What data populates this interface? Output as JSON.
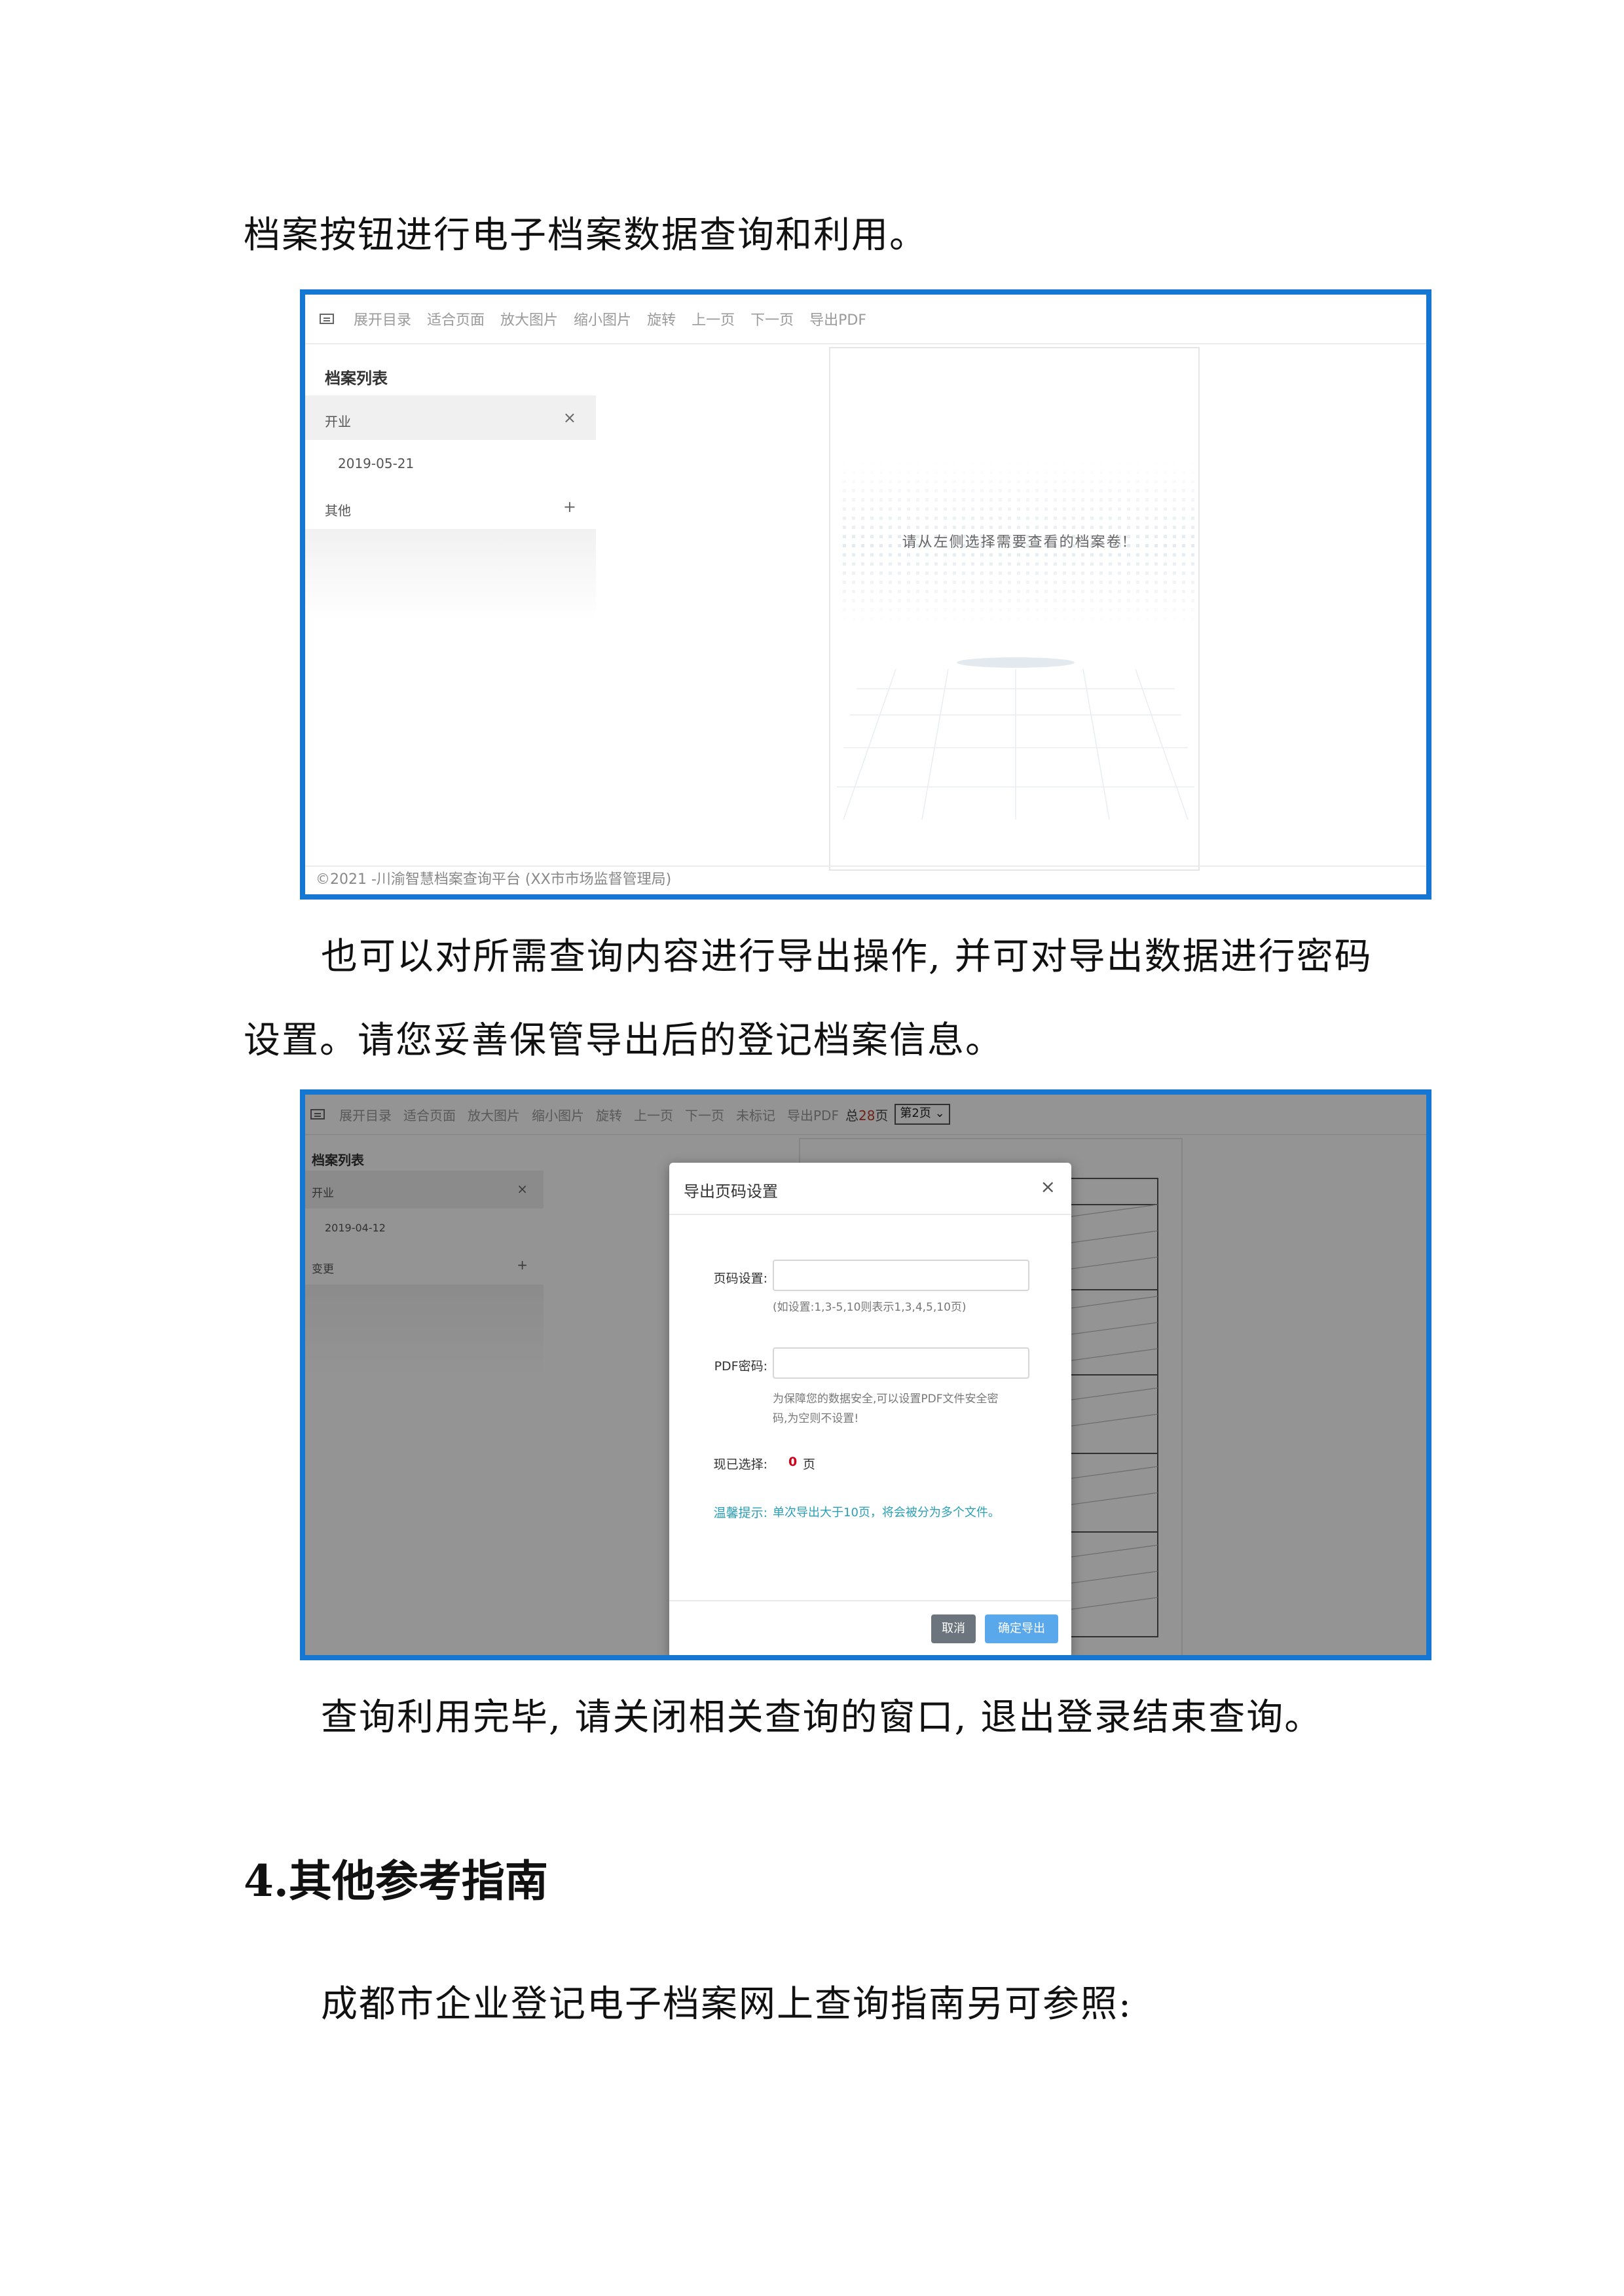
{
  "paragraphs": {
    "p1": "档案按钮进行电子档案数据查询和利用。",
    "p2_line1": "也可以对所需查询内容进行导出操作, 并可对导出数据进行密码",
    "p2_line2": "设置。请您妥善保管导出后的登记档案信息。",
    "p3": "查询利用完毕, 请关闭相关查询的窗口, 退出登录结束查询。",
    "p4": "成都市企业登记电子档案网上查询指南另可参照:"
  },
  "heading": "4.其他参考指南",
  "screenshot1": {
    "toolbar": [
      "展开目录",
      "适合页面",
      "放大图片",
      "缩小图片",
      "旋转",
      "上一页",
      "下一页",
      "导出PDF"
    ],
    "sidebar_title": "档案列表",
    "rows": [
      {
        "label": "开业",
        "action": "×"
      },
      {
        "label": "2019-05-21",
        "action": ""
      },
      {
        "label": "其他",
        "action": "+"
      }
    ],
    "placeholder_text": "请从左侧选择需要查看的档案卷!",
    "footer": "©2021 -川渝智慧档案查询平台 (XX市市场监督管理局)"
  },
  "screenshot2": {
    "toolbar": [
      "展开目录",
      "适合页面",
      "放大图片",
      "缩小图片",
      "旋转",
      "上一页",
      "下一页",
      "未标记",
      "导出PDF"
    ],
    "total_prefix": "总",
    "total_pages": "28",
    "total_suffix": "页",
    "page_select": "第2页",
    "sidebar_title": "档案列表",
    "rows": [
      {
        "label": "开业",
        "action": "×"
      },
      {
        "label": "2019-04-12",
        "action": ""
      },
      {
        "label": "变更",
        "action": "+"
      }
    ],
    "modal": {
      "title": "导出页码设置",
      "close": "×",
      "page_label": "页码设置:",
      "page_hint": "(如设置:1,3-5,10则表示1,3,4,5,10页)",
      "pwd_label": "PDF密码:",
      "pwd_hint_line1": "为保障您的数据安全,可以设置PDF文件安全密",
      "pwd_hint_line2": "码,为空则不设置!",
      "selected_label": "现已选择:",
      "selected_count": "0",
      "selected_unit": "页",
      "tip_label": "温馨提示:",
      "tip_text": "单次导出大于10页，将会被分为多个文件。",
      "cancel": "取消",
      "confirm": "确定导出"
    }
  },
  "colors": {
    "frame": "#1677d2",
    "confirm_button": "#5aa8ec",
    "cancel_button": "#6c757d",
    "tip": "#2a9fb5",
    "count": "#d0021b"
  }
}
